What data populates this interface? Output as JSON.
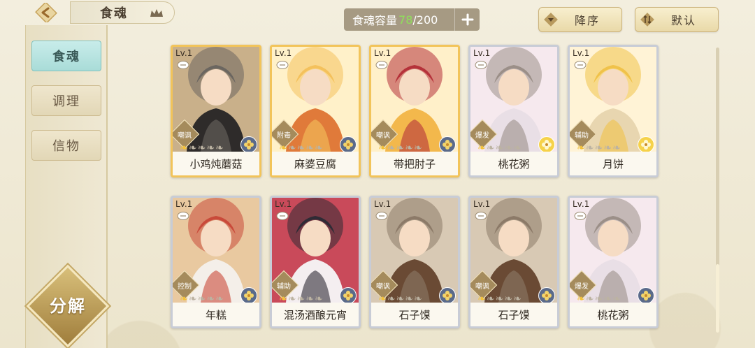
{
  "header": {
    "title": "食魂",
    "capacity_label": "食魂容量",
    "capacity_current": "78",
    "capacity_max": "/200",
    "sort_order_label": "降序",
    "sort_default_label": "默认"
  },
  "sidebar": {
    "items": [
      {
        "label": "食魂",
        "active": true
      },
      {
        "label": "调理",
        "active": false
      },
      {
        "label": "信物",
        "active": false
      }
    ],
    "decompose_label": "分解"
  },
  "cards": [
    {
      "level": "Lv.1",
      "role": "嘲讽",
      "name": "小鸡炖蘑菇",
      "rarity": "gold",
      "lit_stars": 1,
      "badge": "blue"
    },
    {
      "level": "Lv.1",
      "role": "附毒",
      "name": "麻婆豆腐",
      "rarity": "gold",
      "lit_stars": 1,
      "badge": "blue"
    },
    {
      "level": "Lv.1",
      "role": "嘲讽",
      "name": "带把肘子",
      "rarity": "gold",
      "lit_stars": 1,
      "badge": "blue"
    },
    {
      "level": "Lv.1",
      "role": "爆发",
      "name": "桃花粥",
      "rarity": "silver",
      "lit_stars": 1,
      "badge": "yellow"
    },
    {
      "level": "Lv.1",
      "role": "辅助",
      "name": "月饼",
      "rarity": "silver",
      "lit_stars": 1,
      "badge": "yellow"
    },
    {
      "level": "Lv.1",
      "role": "控制",
      "name": "年糕",
      "rarity": "silver",
      "lit_stars": 1,
      "badge": "blue"
    },
    {
      "level": "Lv.1",
      "role": "辅助",
      "name": "混汤酒酿元宵",
      "rarity": "silver",
      "lit_stars": 1,
      "badge": "blue"
    },
    {
      "level": "Lv.1",
      "role": "嘲讽",
      "name": "石子馍",
      "rarity": "silver",
      "lit_stars": 1,
      "badge": "blue"
    },
    {
      "level": "Lv.1",
      "role": "嘲讽",
      "name": "石子馍",
      "rarity": "silver",
      "lit_stars": 1,
      "badge": "blue"
    },
    {
      "level": "Lv.1",
      "role": "爆发",
      "name": "桃花粥",
      "rarity": "silver",
      "lit_stars": 1,
      "badge": "blue"
    }
  ],
  "colors": {
    "accent_green": "#8fe05a",
    "gold_frame": "#f2c45a",
    "silver_frame": "#c8ccd6",
    "active_tab": "#a9dcd8"
  },
  "icons": [
    "back-arrow-icon",
    "crown-icon",
    "plus-icon",
    "sort-down-icon",
    "sort-arrows-icon",
    "speech-bubble-icon",
    "flower-badge-icon"
  ]
}
